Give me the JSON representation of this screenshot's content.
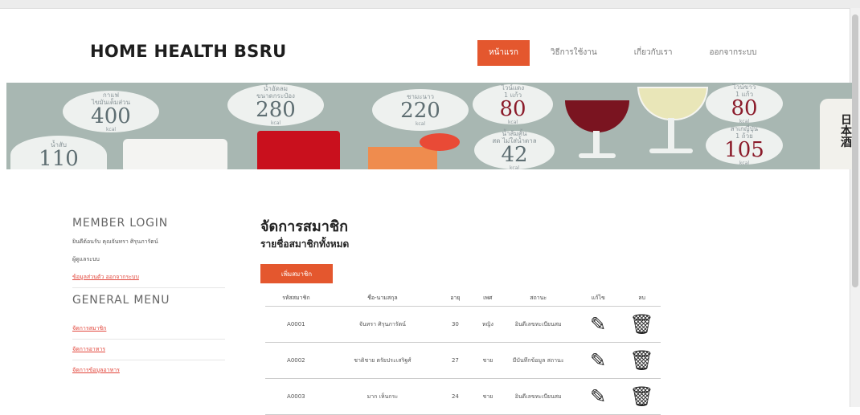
{
  "brand": "HOME HEALTH BSRU",
  "nav": {
    "items": [
      {
        "label": "หน้าแรก",
        "active": true
      },
      {
        "label": "วิธีการใช้งาน",
        "active": false
      },
      {
        "label": "เกี่ยวกับเรา",
        "active": false
      },
      {
        "label": "ออกจากระบบ",
        "active": false
      }
    ]
  },
  "banner": {
    "bubbles": [
      {
        "top": "กาแฟ",
        "sub": "ไขมันเต็มส่วน",
        "num": "400",
        "unit": "kcal"
      },
      {
        "top": "น้ำสับ",
        "sub": "",
        "num": "110",
        "unit": ""
      },
      {
        "top": "น้ำอัดลม",
        "sub": "ขนาดกระป๋อง",
        "num": "280",
        "unit": "kcal"
      },
      {
        "top": "ชามะนาว",
        "sub": "",
        "num": "220",
        "unit": "kcal"
      },
      {
        "top": "ไวน์แดง",
        "sub": "1 แก้ว",
        "num": "80",
        "unit": "kcal"
      },
      {
        "top": "น้ำส้มคั้น",
        "sub": "สด ไม่ใส่น้ำตาล",
        "num": "42",
        "unit": "kcal"
      },
      {
        "top": "ไวน์ขาว",
        "sub": "1 แก้ว",
        "num": "80",
        "unit": "kcal"
      },
      {
        "top": "สาเกญี่ปุ่น",
        "sub": "1 ถ้วย",
        "num": "105",
        "unit": "kcal"
      }
    ],
    "bottle_label": "日本酒"
  },
  "sidebar": {
    "login_heading": "MEMBER LOGIN",
    "welcome_text": "ยินดีต้อนรับ คุณจันทรา ศิรุนภารัตน์",
    "role_text": "ผู้ดูแลระบบ",
    "profile_link": "ข้อมูลส่วนตัว ออกจากระบบ",
    "menu_heading": "GENERAL MENU",
    "menu_items": [
      "จัดการสมาชิก",
      "จัดการอาหาร",
      "จัดการข้อมูลอาหาร"
    ]
  },
  "main": {
    "title": "จัดการสมาชิก",
    "subtitle": "รายชื่อสมาชิกทั้งหมด",
    "add_button": "เพิ่มสมาชิก",
    "columns": [
      "รหัสสมาชิก",
      "ชื่อ-นามสกุล",
      "อายุ",
      "เพศ",
      "สถานะ",
      "แก้ไข",
      "ลบ"
    ],
    "rows": [
      {
        "id": "A0001",
        "name": "จันทรา ศิรุนภารัตน์",
        "age": "30",
        "sex": "หญิง",
        "status": "อินดีเลขทะเบียนสม"
      },
      {
        "id": "A0002",
        "name": "ชาติชาย ตรัยประเสริฐศ์",
        "age": "27",
        "sex": "ชาย",
        "status": "มีบันทึกข้อมูล สถานะ"
      },
      {
        "id": "A0003",
        "name": "มาก เห็นกระ",
        "age": "24",
        "sex": "ชาย",
        "status": "อินดีเลขทะเบียนสม"
      }
    ]
  }
}
